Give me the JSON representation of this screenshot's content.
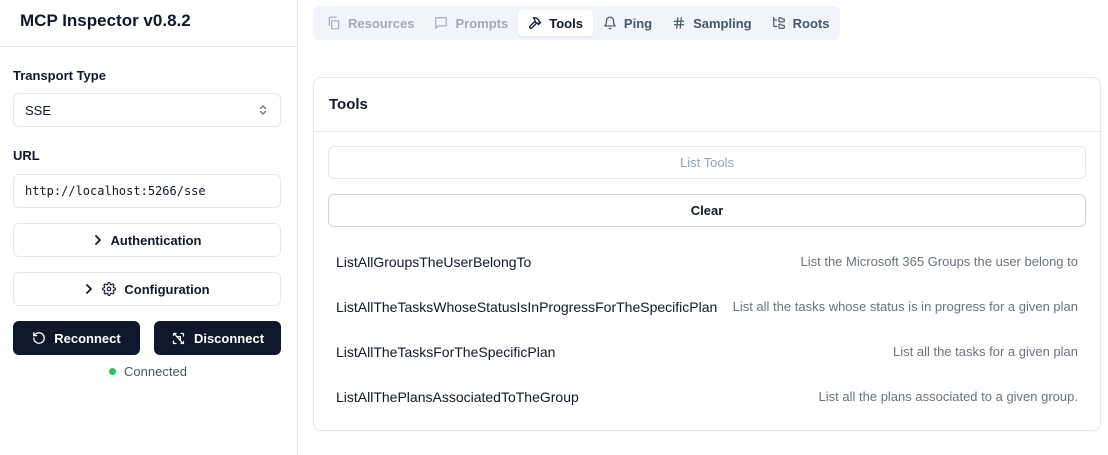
{
  "app": {
    "title": "MCP Inspector v0.8.2"
  },
  "sidebar": {
    "transport_label": "Transport Type",
    "transport_value": "SSE",
    "url_label": "URL",
    "url_value": "http://localhost:5266/sse",
    "auth_label": "Authentication",
    "config_label": "Configuration",
    "reconnect_label": "Reconnect",
    "disconnect_label": "Disconnect",
    "status_text": "Connected",
    "status_color": "#22c55e"
  },
  "tabs": [
    {
      "label": "Resources",
      "icon": "files-icon",
      "state": "disabled"
    },
    {
      "label": "Prompts",
      "icon": "message-square-icon",
      "state": "disabled"
    },
    {
      "label": "Tools",
      "icon": "hammer-icon",
      "state": "active"
    },
    {
      "label": "Ping",
      "icon": "bell-icon",
      "state": "normal"
    },
    {
      "label": "Sampling",
      "icon": "hash-icon",
      "state": "normal"
    },
    {
      "label": "Roots",
      "icon": "folder-tree-icon",
      "state": "normal"
    }
  ],
  "tools_panel": {
    "title": "Tools",
    "list_button": "List Tools",
    "clear_button": "Clear",
    "items": [
      {
        "name": "ListAllGroupsTheUserBelongTo",
        "description": "List the Microsoft 365 Groups the user belong to"
      },
      {
        "name": "ListAllTheTasksWhoseStatusIsInProgressForTheSpecificPlan",
        "description": "List all the tasks whose status is in progress for a given plan"
      },
      {
        "name": "ListAllTheTasksForTheSpecificPlan",
        "description": "List all the tasks for a given plan"
      },
      {
        "name": "ListAllThePlansAssociatedToTheGroup",
        "description": "List all the plans associated to a given group."
      }
    ]
  }
}
